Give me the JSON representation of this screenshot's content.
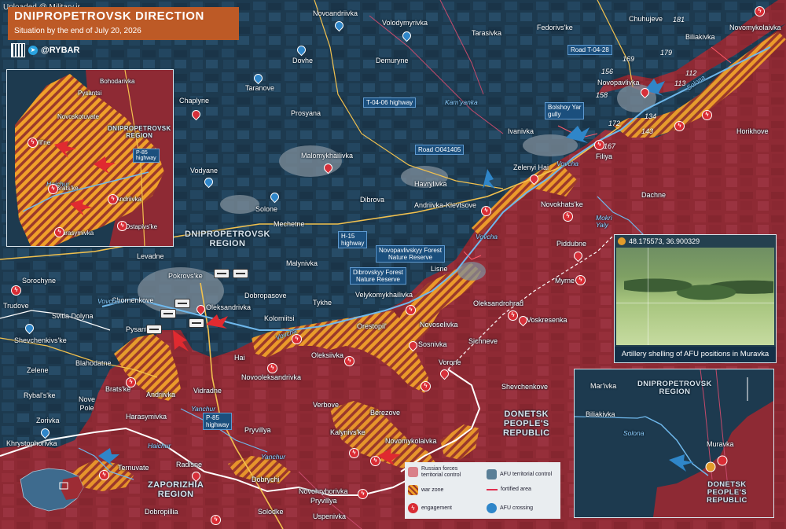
{
  "header": {
    "watermark": "Uploaded @ Military.ir",
    "title": "DNIPROPETROVSK DIRECTION",
    "subtitle": "Situation by the end of July 20, 2026",
    "handle": "@RYBAR"
  },
  "colors": {
    "afu_territory": "#1d3a4f",
    "russian_territory": "#8e2a34",
    "war_zone": "#f0a02a",
    "engagement": "#d92c34",
    "road_highway": "#f2c14e",
    "title_bg": "#bd5a26"
  },
  "regions": {
    "dnipropetrovsk": "DNIPROPETROVSK\nREGION",
    "zaporizhia": "ZAPORIZHIA\nREGION",
    "donetsk": "DONETSK\nPEOPLE'S\nREPUBLIC"
  },
  "towns": {
    "novoandriivka": "Novoandriivka",
    "volodymyrivka": "Volodymyrivka",
    "tarasivka": "Tarasivka",
    "fedorivske": "Fedorivs'ke",
    "chuhujeve": "Chuhujeve",
    "biliakivka": "Biliakivka",
    "novomykolaivka_ne": "Novomykolaivka",
    "dovhe": "Dovhe",
    "demuryne": "Demuryne",
    "taranove": "Taranove",
    "kamyanka": "Kam'yanka",
    "chaplyne": "Chaplyne",
    "prosyana": "Prosyana",
    "novopavlivka": "Novopavlivka",
    "horikhove": "Horikhove",
    "ivanivka": "Ivanivka",
    "malomykhailivka": "Malomykhailivka",
    "vodyane": "Vodyane",
    "filiya": "Filiya",
    "zelenyi_hai": "Zelenyi Hai",
    "havrylivka": "Havrylivka",
    "dachne": "Dachne",
    "andriivka_klevtsove": "Andriivka-Klevtsove",
    "dibrova": "Dibrova",
    "novokhatske": "Novokhats'ke",
    "solone": "Solone",
    "mechetne": "Mechetne",
    "piddubne": "Piddubne",
    "levadne": "Levadne",
    "malynivka": "Malynivka",
    "sorochyne": "Sorochyne",
    "pokrovske": "Pokrovs'ke",
    "lisne": "Lisne",
    "myrne": "Myrne",
    "trudove": "Trudove",
    "chornenkove": "Chornenkove",
    "dobropasove": "Dobropasove",
    "velykomykhailivka": "Velykomykhailivka",
    "oleksandrohrad": "Oleksandrohrad",
    "svitla_dolyna": "Svitla Dolyna",
    "oleksandrivka": "Oleksandrivka",
    "tykhe": "Tykhe",
    "voskresenka": "Voskresenka",
    "pysantsi": "Pysantsi",
    "kolomiitsi": "Kolomiitsi",
    "orestopil": "Orestopil'",
    "novoselivka": "Novoselivka",
    "shevchenkivske": "Shevchenkivs'ke",
    "sosnivka": "Sosnivka",
    "sichneve": "Sichneve",
    "blahodatne": "Blahodatne",
    "hai": "Hai",
    "oleksiivka": "Oleksiivka",
    "vorone": "Vorone",
    "zelene": "Zelene",
    "novooleksandrivka": "Novooleksandrivka",
    "shevchenkove": "Shevchenkove",
    "rybalske": "Rybal's'ke",
    "bratske": "Brats'ke",
    "andriivka": "Andriivka",
    "vidradne": "Vidradne",
    "verbove": "Verbove",
    "nove_pole": "Nove\nPole",
    "berezove": "Berezove",
    "zorivka": "Zorivka",
    "harasymivka": "Harasymivka",
    "kalynivske": "Kalynivs'ke",
    "novomykolaivka": "Novomykolaivka",
    "pryvillya": "Pryvillya",
    "khrystophorivka": "Khrystophorivka",
    "ternuvate": "Ternuvate",
    "radisne": "Radisne",
    "dobrychi": "Dobrychi",
    "dobropillia": "Dobropillia",
    "novohryhorivka": "Novohryhorivka",
    "pryvillya2": "Pryvillya",
    "solodke": "Solodke",
    "uspenivka": "Uspenivka",
    "muravka": "Muravka"
  },
  "rivers": {
    "vovcha_1": "Vovcha",
    "vovcha_2": "Vovcha",
    "vovcha_3": "Vovcha",
    "vovcha_4": "Vovcha",
    "solona": "Solona",
    "haichur": "Haichur",
    "yanchur": "Yanchur",
    "yanchur2": "Yanchur",
    "mokri_yaly": "Mokri\nYaly"
  },
  "road_tags": {
    "t0406": "T-04-06 highway",
    "o041405": "Road O041405",
    "t0428": "Road T-04-28",
    "h15": "H-15\nhighway",
    "p85": "P-85\nhighway",
    "bolshoy_yar": "Bolshoy Yar\ngully"
  },
  "forests": {
    "novopavlivskyy": "Novopavlivskyy Forest\nNature Reserve",
    "dibrovskyy": "Dibrovskyy Forest\nNature Reserve"
  },
  "elevations": [
    "181",
    "169",
    "179",
    "156",
    "112",
    "158",
    "113",
    "172",
    "134",
    "143",
    "167"
  ],
  "inset_left": {
    "region": "DNIPROPETROVSK\nREGION",
    "bohodarivka": "Bohodarivka",
    "pysantsi": "Pysantsi",
    "novoskotuvate": "Novoskotuvate",
    "vilne": "Vil'ne",
    "bratske": "Brats'ke",
    "andriivka": "Andriivka",
    "ostapivske": "Ostapivs'ke",
    "harasymivka": "Harasymivka",
    "p85": "P-85\nhighway",
    "haichur": "Haichur"
  },
  "inset_right": {
    "region_top": "DNIPROPETROVSK\nREGION",
    "region_bottom": "DONETSK\nPEOPLE'S\nREPUBLIC",
    "marivka": "Mar'ivka",
    "biliakivka": "Biliakivka",
    "muravka": "Muravka",
    "solona": "Solona"
  },
  "photo": {
    "coords": "48.175573, 36.900329",
    "caption": "Artillery shelling of AFU positions in Muravka"
  },
  "legend": {
    "russian": "Russian forces\nterritorial control",
    "afu": "AFU territorial control",
    "war_zone": "war zone",
    "fortified": "fortified area",
    "engagement": "engagement",
    "crossing": "AFU crossing"
  }
}
